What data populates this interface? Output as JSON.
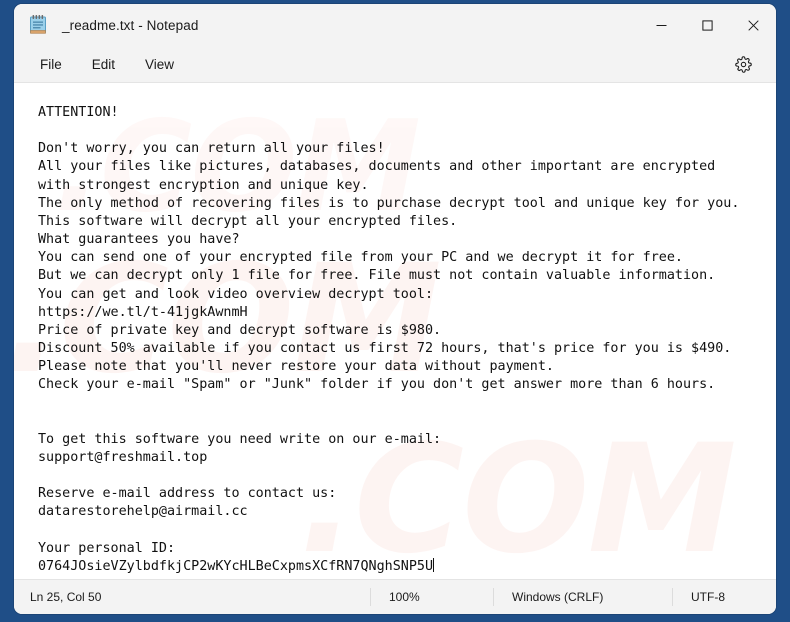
{
  "window": {
    "title": "_readme.txt - Notepad",
    "icon": "notepad-icon",
    "controls": {
      "minimize": "minimize-icon",
      "maximize": "maximize-icon",
      "close": "close-icon"
    }
  },
  "menubar": {
    "items": [
      {
        "label": "File"
      },
      {
        "label": "Edit"
      },
      {
        "label": "View"
      }
    ],
    "settings_icon": "gear-icon"
  },
  "editor": {
    "watermark": ".COM",
    "content": "ATTENTION!\n\nDon't worry, you can return all your files!\nAll your files like pictures, databases, documents and other important are encrypted\nwith strongest encryption and unique key.\nThe only method of recovering files is to purchase decrypt tool and unique key for you.\nThis software will decrypt all your encrypted files.\nWhat guarantees you have?\nYou can send one of your encrypted file from your PC and we decrypt it for free.\nBut we can decrypt only 1 file for free. File must not contain valuable information.\nYou can get and look video overview decrypt tool:\nhttps://we.tl/t-41jgkAwnmH\nPrice of private key and decrypt software is $980.\nDiscount 50% available if you contact us first 72 hours, that's price for you is $490.\nPlease note that you'll never restore your data without payment.\nCheck your e-mail \"Spam\" or \"Junk\" folder if you don't get answer more than 6 hours.\n\n\nTo get this software you need write on our e-mail:\nsupport@freshmail.top\n\nReserve e-mail address to contact us:\ndatarestorehelp@airmail.cc\n\nYour personal ID:\n0764JOsieVZylbdfkjCP2wKYcHLBeCxpmsXCfRN7QNghSNP5U"
  },
  "statusbar": {
    "line_col": "Ln 25, Col 50",
    "zoom": "100%",
    "line_ending": "Windows (CRLF)",
    "encoding": "UTF-8"
  },
  "colors": {
    "desktop": "#1f4e87",
    "chrome": "#f3f3f3",
    "editor_bg": "#ffffff",
    "text": "#111111",
    "watermark": "#e8472a"
  }
}
